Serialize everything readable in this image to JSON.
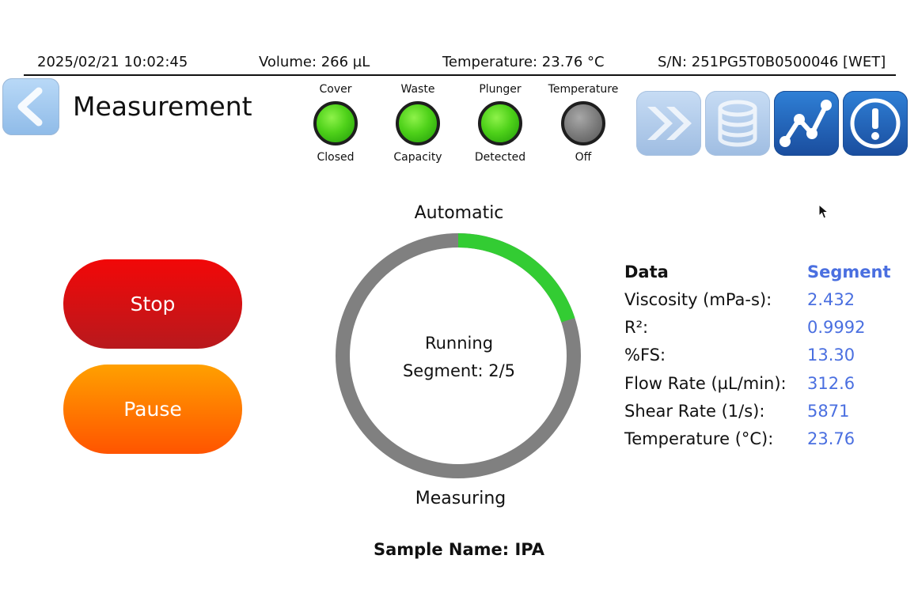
{
  "status": {
    "datetime": "2025/02/21 10:02:45",
    "volume": "Volume: 266 µL",
    "temperature": "Temperature: 23.76 °C",
    "serial": "S/N: 251PG5T0B0500046 [WET]"
  },
  "header": {
    "title": "Measurement"
  },
  "indicators": [
    {
      "label": "Cover",
      "state": "Closed",
      "on": true
    },
    {
      "label": "Waste",
      "state": "Capacity",
      "on": true
    },
    {
      "label": "Plunger",
      "state": "Detected",
      "on": true
    },
    {
      "label": "Temperature",
      "state": "Off",
      "on": false
    }
  ],
  "tools": [
    {
      "icon": "fast-forward-icon",
      "enabled": false
    },
    {
      "icon": "database-icon",
      "enabled": false
    },
    {
      "icon": "line-chart-icon",
      "enabled": true
    },
    {
      "icon": "alert-icon",
      "enabled": true
    }
  ],
  "actions": {
    "stop_label": "Stop",
    "pause_label": "Pause"
  },
  "progress": {
    "mode": "Automatic",
    "status": "Running",
    "segment": "Segment: 2/5",
    "phase": "Measuring",
    "fraction": 0.2,
    "color_done": "#33cc33",
    "color_remaining": "#808080"
  },
  "data_table": {
    "header_label": "Data",
    "header_value": "Segment",
    "rows": [
      {
        "label": "Viscosity (mPa-s):",
        "value": "2.432"
      },
      {
        "label": "R²:",
        "value": "0.9992"
      },
      {
        "label": "%FS:",
        "value": "13.30"
      },
      {
        "label": "Flow Rate (µL/min):",
        "value": "312.6"
      },
      {
        "label": "Shear Rate (1/s):",
        "value": "5871"
      },
      {
        "label": "Temperature (°C):",
        "value": "23.76"
      }
    ]
  },
  "sample": {
    "name": "Sample Name: IPA"
  },
  "colors": {
    "accent_blue": "#4a6fe0",
    "stop_red": "#e01010",
    "pause_orange": "#ff7a00"
  }
}
